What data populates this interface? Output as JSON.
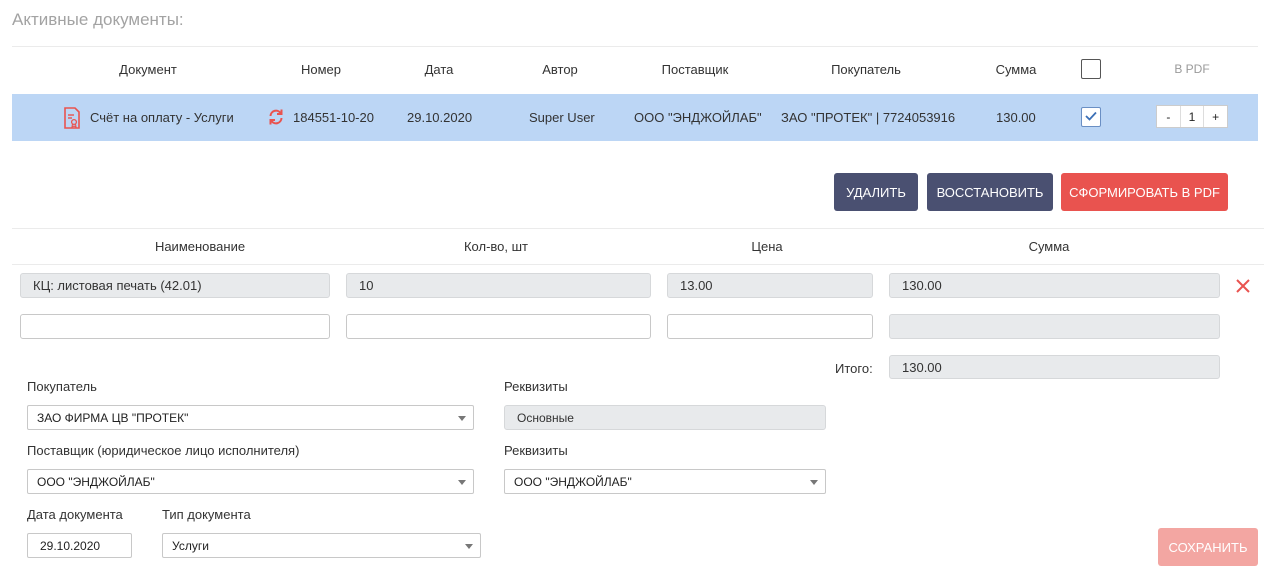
{
  "page": {
    "section_title": "Активные документы:"
  },
  "table": {
    "headers": {
      "document": "Документ",
      "number": "Номер",
      "date": "Дата",
      "author": "Автор",
      "supplier": "Поставщик",
      "buyer": "Покупатель",
      "sum": "Сумма",
      "pdf": "В PDF"
    },
    "row": {
      "document": "Счёт на оплату - Услуги",
      "number": "184551-10-20",
      "date": "29.10.2020",
      "author": "Super User",
      "supplier": "ООО \"ЭНДЖОЙЛАБ\"",
      "buyer": "ЗАО \"ПРОТЕК\" | 7724053916",
      "sum": "130.00",
      "checked": true,
      "pdf_minus": "-",
      "pdf_count": "1",
      "pdf_plus": "+"
    }
  },
  "actions": {
    "delete": "УДАЛИТЬ",
    "restore": "ВОССТАНОВИТЬ",
    "make_pdf": "СФОРМИРОВАТЬ В PDF"
  },
  "items": {
    "headers": {
      "name": "Наименование",
      "qty": "Кол-во, шт",
      "price": "Цена",
      "sum": "Сумма"
    },
    "rows": [
      {
        "name": "КЦ: листовая печать (42.01)",
        "qty": "10",
        "price": "13.00",
        "sum": "130.00"
      },
      {
        "name": "",
        "qty": "",
        "price": "",
        "sum": ""
      }
    ],
    "total_label": "Итого:",
    "total_value": "130.00"
  },
  "form": {
    "buyer_label": "Покупатель",
    "buyer_value": "ЗАО ФИРМА ЦВ \"ПРОТЕК\"",
    "buyer_req_label": "Реквизиты",
    "buyer_req_value": "Основные",
    "supplier_label": "Поставщик (юридическое лицо исполнителя)",
    "supplier_value": "ООО \"ЭНДЖОЙЛАБ\"",
    "supplier_req_label": "Реквизиты",
    "supplier_req_value": "ООО \"ЭНДЖОЙЛАБ\"",
    "doc_date_label": "Дата документа",
    "doc_date_value": "29.10.2020",
    "doc_type_label": "Тип документа",
    "doc_type_value": "Услуги",
    "save": "СОХРАНИТЬ"
  },
  "colors": {
    "selected_row": "#bcd6f5",
    "dark_button": "#4a5071",
    "red_button": "#e9534f",
    "save_button_disabled": "#f3a6a2",
    "icon_red": "#e9534f"
  },
  "icons": {
    "document": "document-icon",
    "refresh": "refresh-icon",
    "delete_row": "close-icon",
    "check": "check-icon"
  }
}
